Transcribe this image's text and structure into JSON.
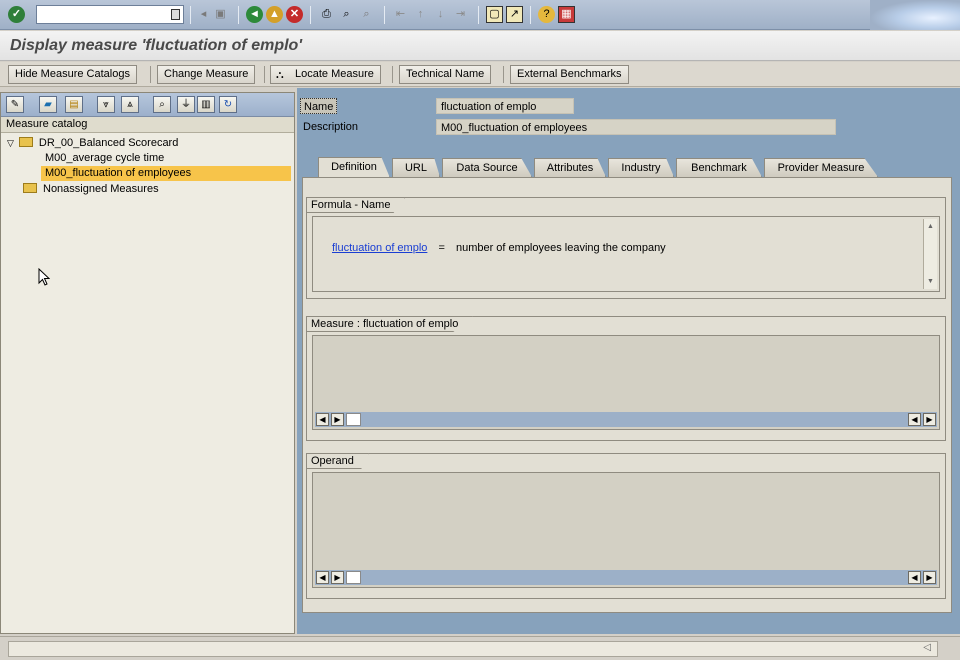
{
  "window": {
    "title": "Display measure 'fluctuation of emplo'"
  },
  "toolbar": {
    "command_value": "",
    "icons": [
      "enter-icon",
      "back-icon",
      "exit-icon",
      "cancel-icon",
      "print-icon",
      "find-icon",
      "find-next-icon",
      "first-page-icon",
      "prev-page-icon",
      "next-page-icon",
      "last-page-icon",
      "new-session-icon",
      "shortcut-icon",
      "help-icon",
      "layout-icon"
    ]
  },
  "app_toolbar": {
    "hide_catalogs": "Hide Measure Catalogs",
    "change_measure": "Change Measure",
    "locate_measure": "Locate Measure",
    "technical_name": "Technical Name",
    "external_benchmarks": "External Benchmarks"
  },
  "catalog": {
    "header": "Measure catalog",
    "tree": [
      {
        "label": "DR_00_Balanced Scorecard",
        "type": "folder",
        "expanded": true
      },
      {
        "label": "M00_average cycle time",
        "type": "leaf"
      },
      {
        "label": "M00_fluctuation of employees",
        "type": "leaf",
        "selected": true
      },
      {
        "label": "Nonassigned Measures",
        "type": "folder"
      }
    ]
  },
  "detail": {
    "name_label": "Name",
    "name_value": "fluctuation of emplo",
    "description_label": "Description",
    "description_value": "M00_fluctuation of employees"
  },
  "tabs": [
    "Definition",
    "URL",
    "Data Source",
    "Attributes",
    "Industry",
    "Benchmark",
    "Provider Measure"
  ],
  "formula": {
    "group_title": "Formula - Name",
    "link_text": "fluctuation of emplo",
    "equals": "=",
    "expression": "number of employees leaving the company"
  },
  "measure_group": {
    "title": "Measure : fluctuation of emplo"
  },
  "operand_group": {
    "title": "Operand"
  },
  "colors": {
    "selection": "#f7c44a",
    "link": "#1a3ed3",
    "pane_background": "#87a2bc"
  }
}
